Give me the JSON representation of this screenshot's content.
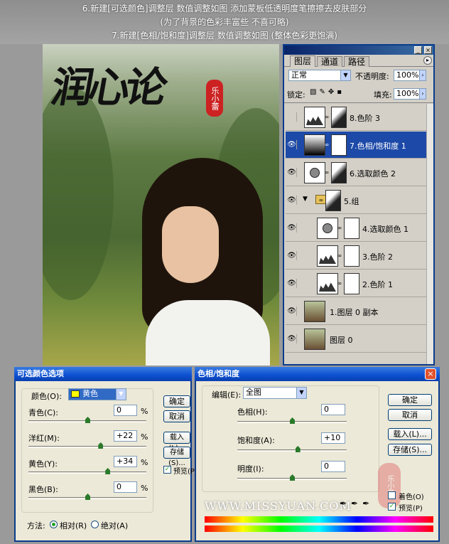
{
  "banner": {
    "line1": "6.新建[可选颜色]调整层 数值调整如图 添加蒙板低透明度笔擦擦去皮肤部分",
    "line2": "(为了背景的色彩丰富些 不喜可略)",
    "line3": "7.新建[色相/饱和度]调整层 数值调整如图 (整体色彩更饱满)"
  },
  "photo": {
    "calligraphy": "润心论",
    "seal": "乐小蕾"
  },
  "layers_panel": {
    "tabs": [
      "图层",
      "通道",
      "路径"
    ],
    "blend_mode": "正常",
    "opacity_label": "不透明度:",
    "opacity_value": "100%",
    "lock_label": "锁定:",
    "fill_label": "填充:",
    "fill_value": "100%",
    "layers": [
      {
        "name": "8.色阶 3",
        "visible": false,
        "selected": false,
        "thumb": "levels-icon",
        "mask": "dark"
      },
      {
        "name": "7.色相/饱和度 1",
        "visible": true,
        "selected": true,
        "thumb": "gradient",
        "mask": "white"
      },
      {
        "name": "6.选取颜色 2",
        "visible": true,
        "selected": false,
        "thumb": "selective-color-icon",
        "mask": "dark"
      },
      {
        "name": "5.组",
        "visible": true,
        "selected": false,
        "thumb": "folder-icon",
        "mask": "dark"
      },
      {
        "name": "4.选取颜色 1",
        "visible": true,
        "selected": false,
        "thumb": "selective-color-icon",
        "mask": "white"
      },
      {
        "name": "3.色阶 2",
        "visible": true,
        "selected": false,
        "thumb": "levels-icon",
        "mask": "white"
      },
      {
        "name": "2.色阶 1",
        "visible": true,
        "selected": false,
        "thumb": "levels-icon",
        "mask": "white"
      },
      {
        "name": "1.图层 0 副本",
        "visible": true,
        "selected": false,
        "thumb": "photo",
        "mask": "none"
      },
      {
        "name": "图层 0",
        "visible": true,
        "selected": false,
        "thumb": "photo",
        "mask": "none"
      }
    ]
  },
  "selective_color": {
    "title": "可选颜色选项",
    "colors_label": "颜色(O):",
    "colors_value": "黄色",
    "rows": [
      {
        "label": "青色(C):",
        "value": "0",
        "unit": "%",
        "level": 0
      },
      {
        "label": "洋红(M):",
        "value": "+22",
        "unit": "%",
        "level": 22
      },
      {
        "label": "黄色(Y):",
        "value": "+34",
        "unit": "%",
        "level": 34
      },
      {
        "label": "黑色(B):",
        "value": "0",
        "unit": "%",
        "level": 0
      }
    ],
    "ok": "确定",
    "cancel": "取消",
    "load": "载入(L)...",
    "save": "存储(S)...",
    "preview": "预览(P)",
    "method_label": "方法:",
    "relative": "相对(R)",
    "absolute": "绝对(A)"
  },
  "hue_sat": {
    "title": "色相/饱和度",
    "edit_label": "编辑(E):",
    "edit_value": "全图",
    "rows": [
      {
        "label": "色相(H):",
        "value": "0",
        "level": 0
      },
      {
        "label": "饱和度(A):",
        "value": "+10",
        "level": 10
      },
      {
        "label": "明度(I):",
        "value": "0",
        "level": 0
      }
    ],
    "ok": "确定",
    "cancel": "取消",
    "load": "载入(L)...",
    "save": "存储(S)...",
    "colorize": "着色(O)",
    "preview": "预览(P)",
    "watermark": "WWW.MISSYUAN.COM",
    "seal": "乐小蕾"
  }
}
